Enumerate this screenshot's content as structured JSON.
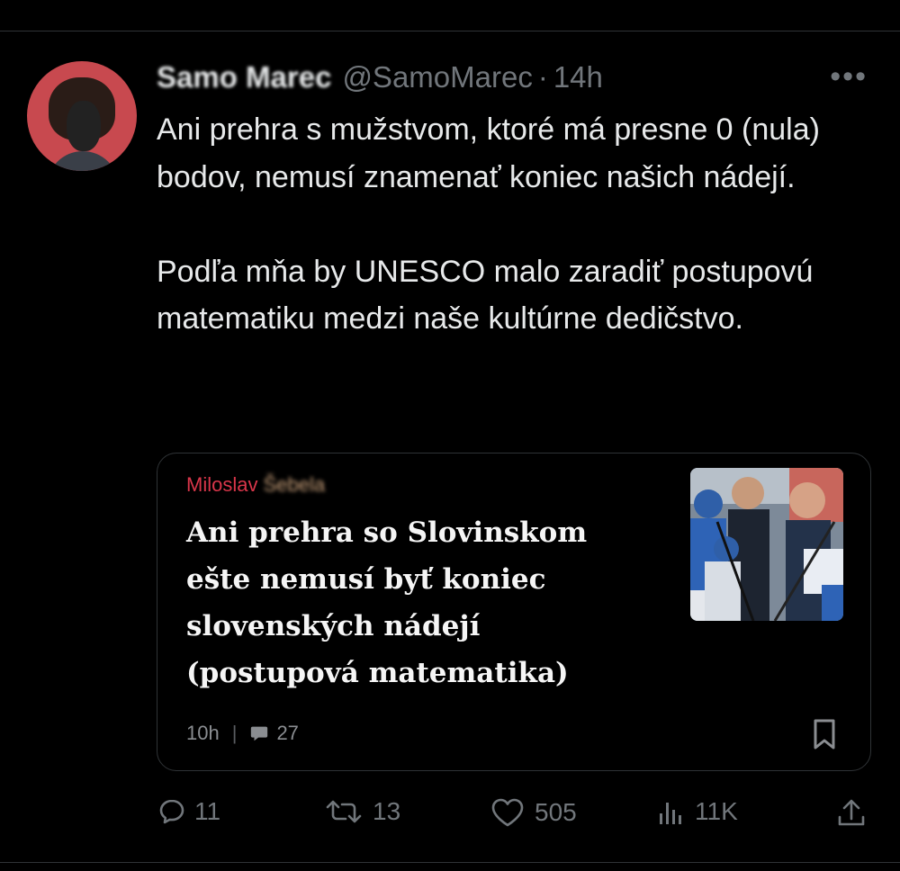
{
  "tweet": {
    "display_name": "Samo Marec",
    "handle": "@SamoMarec",
    "separator": "·",
    "time": "14h",
    "more_label": "•••",
    "text": "Ani prehra s mužstvom, ktoré má presne 0 (nula) bodov, nemusí znamenať koniec našich nádejí.\n\nPodľa mňa by UNESCO malo zaradiť postupovú matematiku medzi naše kultúrne dedičstvo."
  },
  "card": {
    "author_first": "Miloslav",
    "author_last": "Šebela",
    "title": "Ani prehra so Slovinskom ešte nemusí byť koniec slovenských nádejí (postupová matematika)",
    "time": "10h",
    "separator": "|",
    "comments": "27"
  },
  "actions": {
    "replies": "11",
    "retweets": "13",
    "likes": "505",
    "views": "11K"
  },
  "icons": {
    "reply": "reply-icon",
    "retweet": "retweet-icon",
    "like": "heart-icon",
    "views": "views-icon",
    "share": "share-icon",
    "bookmark": "bookmark-icon",
    "comment": "comment-icon"
  },
  "colors": {
    "background": "#000000",
    "text": "#e7e9ea",
    "muted": "#71767b",
    "author_accent": "#d9364a"
  }
}
